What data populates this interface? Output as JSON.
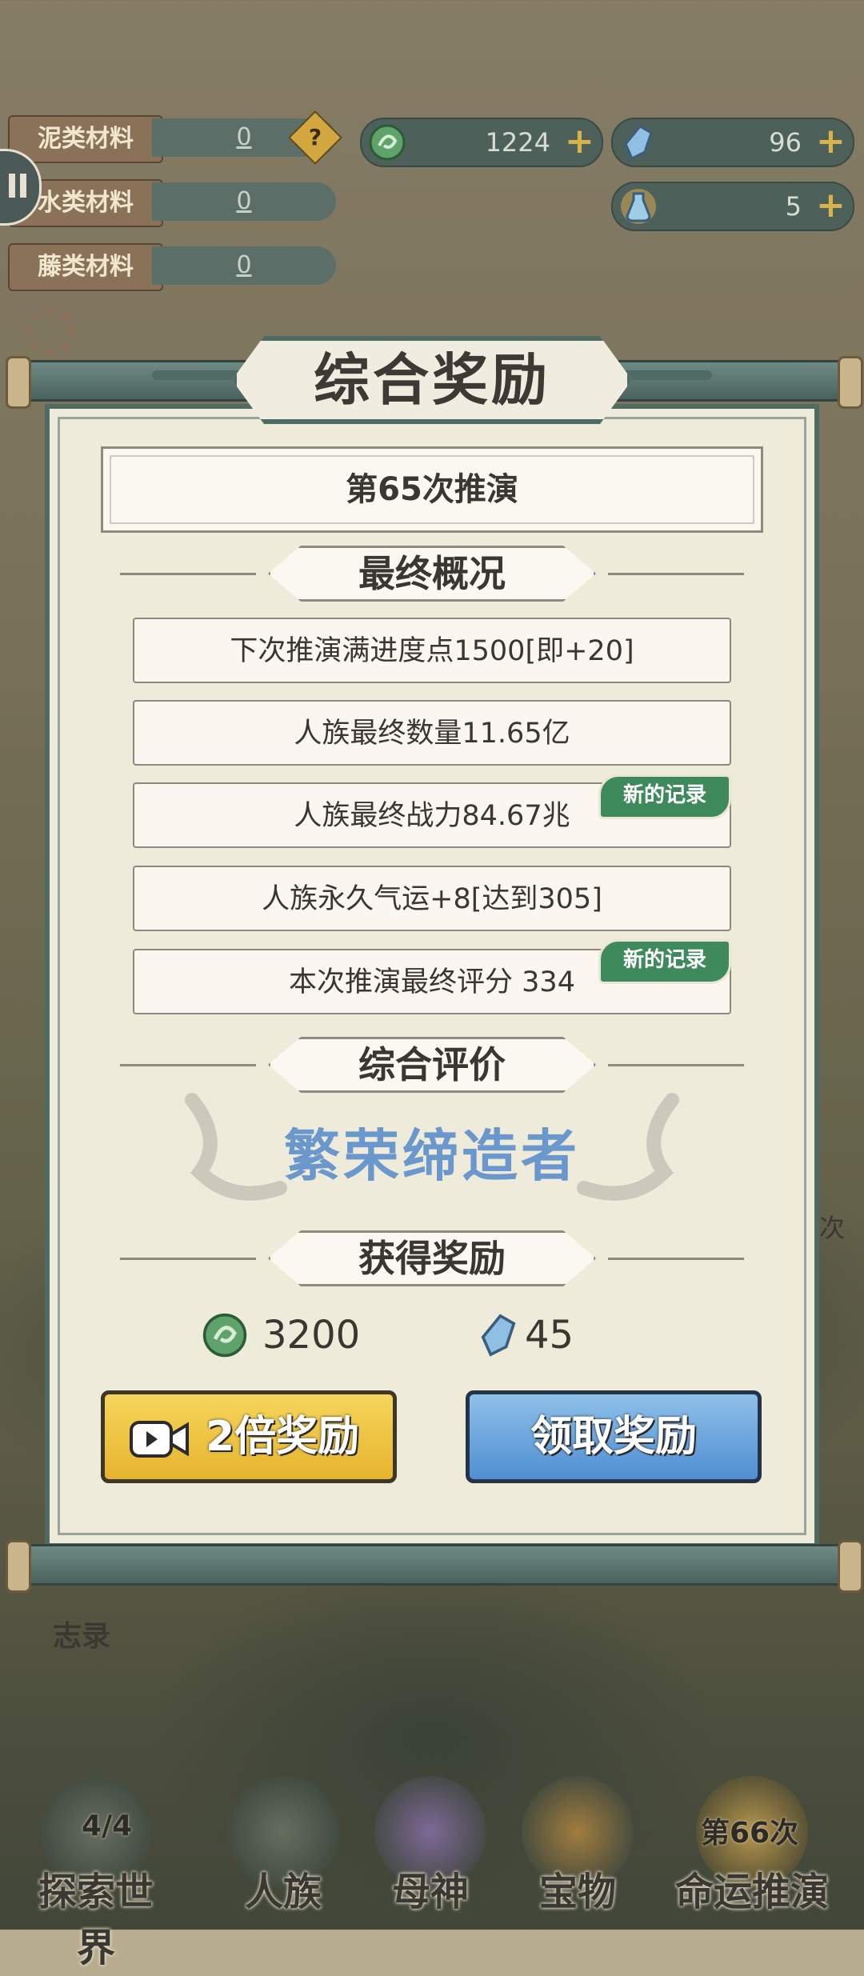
{
  "materials": [
    {
      "label": "泥类材料",
      "value": "0"
    },
    {
      "label": "水类材料",
      "value": "0"
    },
    {
      "label": "藤类材料",
      "value": "0"
    }
  ],
  "resources": {
    "coin": "1224",
    "crystal": "96",
    "potion": "5"
  },
  "dialog": {
    "title": "综合奖励",
    "round": "第65次推演",
    "section_final": "最终概况",
    "stats": [
      "下次推演满进度点1500[即+20]",
      "人族最终数量11.65亿",
      "人族最终战力84.67兆",
      "人族永久气运+8[达到305]",
      "本次推演最终评分 334"
    ],
    "record_label": "新的记录",
    "section_eval": "综合评价",
    "grade": "繁荣缔造者",
    "section_reward": "获得奖励",
    "reward_coin": "3200",
    "reward_crystal": "45",
    "double_button": "2倍奖励",
    "claim_button": "领取奖励"
  },
  "side": {
    "zhilu": "志录",
    "ci": "次"
  },
  "nav": {
    "explore_label": "探索世界",
    "explore_count": "4/4",
    "people_label": "人族",
    "mother_label": "母神",
    "treasure_label": "宝物",
    "fate_label": "命运推演",
    "fate_count": "第66次"
  },
  "colors": {
    "accent_green": "#4f6b63",
    "record_green": "#3e8a5c",
    "grade_blue": "#6b98cc",
    "gold_button": "#e5b42d",
    "blue_button": "#4f8ed1"
  }
}
